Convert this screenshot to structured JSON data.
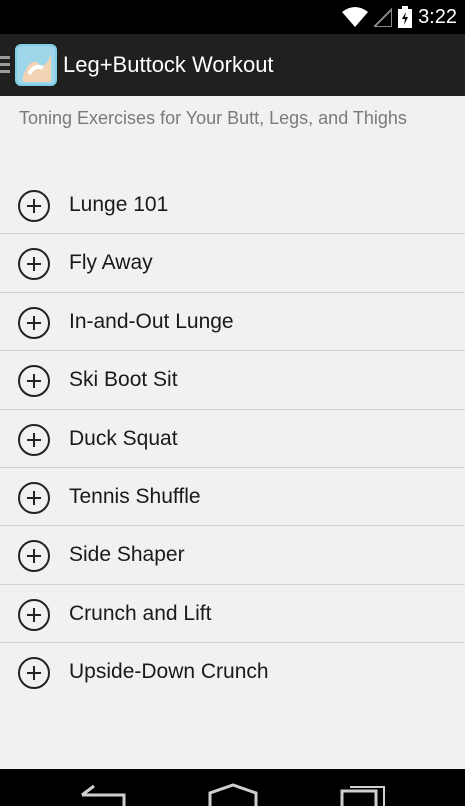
{
  "status": {
    "time": "3:22",
    "icons": [
      "wifi-icon",
      "signal-icon",
      "battery-icon"
    ]
  },
  "header": {
    "title": "Leg+Buttock Workout",
    "menu_icon": "drawer-icon",
    "app_icon": "app-logo"
  },
  "subtitle": "Toning Exercises for Your Butt, Legs, and Thighs",
  "exercises": [
    {
      "label": "Lunge 101"
    },
    {
      "label": "Fly Away"
    },
    {
      "label": "In-and-Out Lunge"
    },
    {
      "label": "Ski Boot Sit"
    },
    {
      "label": "Duck Squat"
    },
    {
      "label": "Tennis Shuffle"
    },
    {
      "label": "Side Shaper"
    },
    {
      "label": "Crunch and Lift"
    },
    {
      "label": "Upside-Down Crunch"
    }
  ],
  "navigation": {
    "buttons": [
      "back-icon",
      "home-icon",
      "recents-icon"
    ]
  },
  "colors": {
    "status_bar": "#000000",
    "action_bar": "#202020",
    "background": "#f1f1f1",
    "subtitle": "#7a7a7a",
    "divider": "#d3d3d3"
  }
}
